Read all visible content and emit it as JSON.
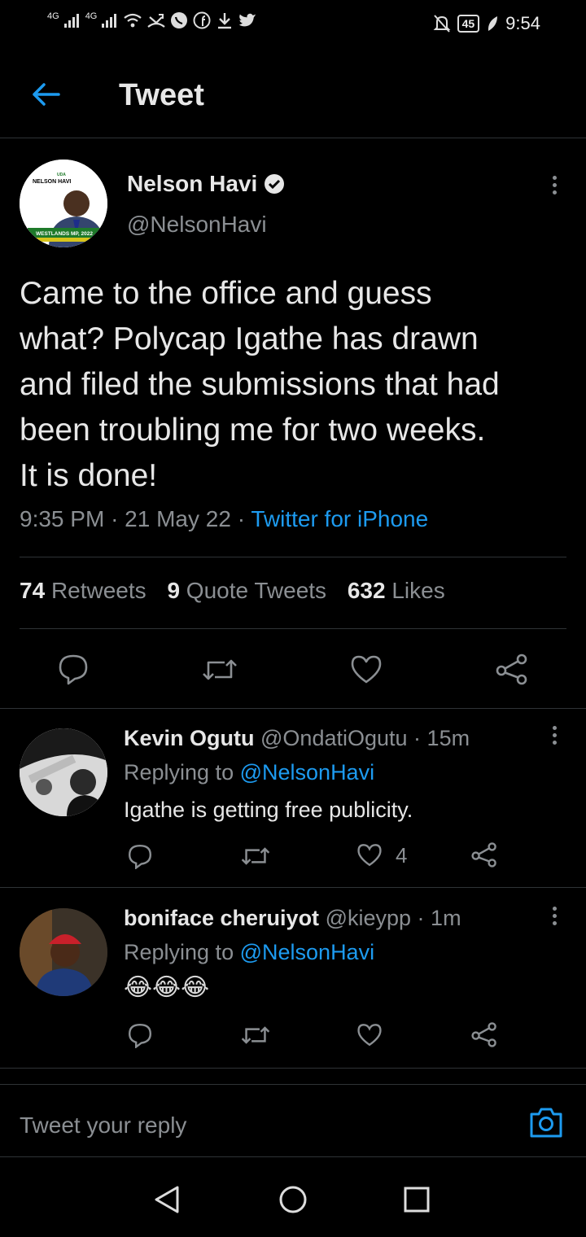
{
  "status_bar": {
    "signal1": "4G",
    "signal2": "4G",
    "battery": "45",
    "time": "9:54"
  },
  "header": {
    "title": "Tweet"
  },
  "tweet": {
    "author_name": "Nelson Havi",
    "author_handle": "@NelsonHavi",
    "lines": [
      "Came to the office and guess",
      "what? Polycap Igathe has drawn",
      "and filed the submissions that had",
      "been troubling me for two weeks.",
      "It is done!"
    ],
    "time": "9:35 PM",
    "date": "21 May 22",
    "source": "Twitter for iPhone",
    "retweets": "74",
    "retweets_label": "Retweets",
    "quotes": "9",
    "quotes_label": "Quote Tweets",
    "likes": "632",
    "likes_label": "Likes"
  },
  "avatar_text": {
    "top": "NELSON HAVI",
    "badge": "UDA",
    "bottom": "WESTLANDS MP, 2022"
  },
  "replies": [
    {
      "name": "Kevin Ogutu",
      "handle": "@OndatiOgutu",
      "time": "15m",
      "replying_prefix": "Replying to",
      "replying_to": "@NelsonHavi",
      "text": "Igathe is getting free publicity.",
      "like_count": "4"
    },
    {
      "name": "boniface cheruiyot",
      "handle": "@kieypp",
      "time": "1m",
      "replying_prefix": "Replying to",
      "replying_to": "@NelsonHavi",
      "text": "😂😂😂",
      "like_count": ""
    }
  ],
  "composer": {
    "placeholder": "Tweet your reply"
  },
  "colors": {
    "accent": "#1d9bf0",
    "background": "#000000",
    "secondary_text": "#8b8f93"
  }
}
